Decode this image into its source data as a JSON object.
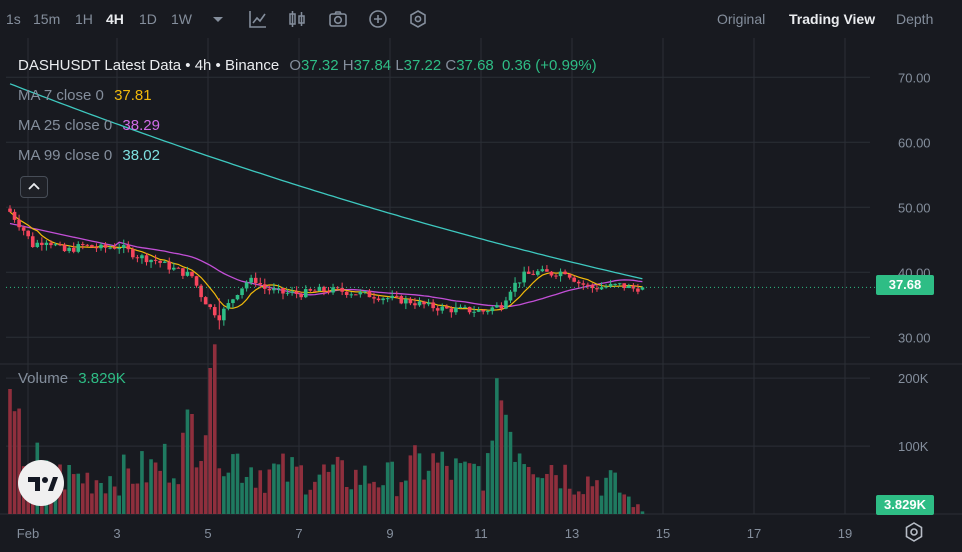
{
  "toolbar": {
    "timeframes": [
      "1s",
      "15m",
      "1H",
      "4H",
      "1D",
      "1W"
    ],
    "active_timeframe": "4H",
    "views": [
      "Original",
      "Trading View",
      "Depth"
    ],
    "active_view": "Trading View",
    "tools": [
      "dropdown-caret-icon",
      "indicator-chart-icon",
      "candle-settings-icon",
      "camera-icon",
      "add-icon",
      "settings-icon"
    ]
  },
  "legend": {
    "title": "DASHUSDT Latest Data • 4h • Binance",
    "ohlc": [
      {
        "k": "O",
        "v": "37.32"
      },
      {
        "k": "H",
        "v": "37.84"
      },
      {
        "k": "L",
        "v": "37.22"
      },
      {
        "k": "C",
        "v": "37.68"
      }
    ],
    "change": "0.36 (+0.99%)",
    "ma7_label": "MA 7 close 0",
    "ma7_value": "37.81",
    "ma25_label": "MA 25 close 0",
    "ma25_value": "38.29",
    "ma99_label": "MA 99 close 0",
    "ma99_value": "38.02",
    "volume_label": "Volume",
    "volume_value": "3.829K"
  },
  "price_tag": "37.68",
  "volume_tag": "3.829K",
  "colors": {
    "up": "#2ebd85",
    "down": "#f6465d",
    "up_vol": "#1f7a60",
    "down_vol": "#8f2f3d",
    "ma7": "#f0b90b",
    "ma25": "#c24fd6",
    "ma99": "#3ec9c0",
    "grid": "#2b2f36",
    "ma7_text": "#f0b90b",
    "ma25_text": "#d16ce8",
    "ma99_text": "#7ee0e0"
  },
  "chart_data": {
    "type": "candlestick",
    "price_axis": {
      "ticks": [
        "70.00",
        "60.00",
        "50.00",
        "40.00",
        "30.00"
      ],
      "tick_values": [
        70,
        60,
        50,
        40,
        30
      ],
      "range": [
        26.5,
        74.5
      ]
    },
    "volume_axis": {
      "ticks": [
        "200K",
        "100K"
      ],
      "tick_values": [
        200000,
        100000
      ],
      "range": [
        0,
        215000
      ]
    },
    "x_axis": {
      "labels": [
        "Feb",
        "3",
        "5",
        "7",
        "9",
        "11",
        "13",
        "15",
        "17",
        "19"
      ]
    },
    "anchors": [
      [
        0,
        49.3
      ],
      [
        3,
        46.5
      ],
      [
        5,
        44.2
      ],
      [
        8,
        45.0
      ],
      [
        12,
        43.2
      ],
      [
        16,
        44.1
      ],
      [
        20,
        43.7
      ],
      [
        24,
        44.0
      ],
      [
        28,
        42.5
      ],
      [
        32,
        41.8
      ],
      [
        36,
        40.5
      ],
      [
        40,
        39.4
      ],
      [
        42,
        36.5
      ],
      [
        44,
        34.5
      ],
      [
        46,
        33.2
      ],
      [
        48,
        35.0
      ],
      [
        50,
        37.0
      ],
      [
        52,
        38.5
      ],
      [
        54,
        38.8
      ],
      [
        56,
        37.5
      ],
      [
        60,
        36.8
      ],
      [
        64,
        36.7
      ],
      [
        68,
        37.2
      ],
      [
        72,
        37.2
      ],
      [
        76,
        36.8
      ],
      [
        80,
        36.4
      ],
      [
        84,
        35.9
      ],
      [
        88,
        35.5
      ],
      [
        92,
        34.8
      ],
      [
        96,
        34.3
      ],
      [
        100,
        34.2
      ],
      [
        104,
        34.0
      ],
      [
        108,
        35.0
      ],
      [
        110,
        37.5
      ],
      [
        113,
        39.5
      ],
      [
        116,
        40.0
      ],
      [
        119,
        39.8
      ],
      [
        122,
        40.2
      ],
      [
        125,
        38.4
      ],
      [
        128,
        37.6
      ],
      [
        131,
        37.8
      ],
      [
        134,
        38.0
      ],
      [
        137,
        37.5
      ],
      [
        139,
        37.68
      ]
    ],
    "vol_anchors": [
      [
        0,
        130000
      ],
      [
        8,
        60000
      ],
      [
        20,
        55000
      ],
      [
        32,
        70000
      ],
      [
        38,
        100000
      ],
      [
        44,
        200000
      ],
      [
        48,
        90000
      ],
      [
        56,
        65000
      ],
      [
        70,
        60000
      ],
      [
        84,
        55000
      ],
      [
        92,
        80000
      ],
      [
        100,
        60000
      ],
      [
        106,
        75000
      ],
      [
        107,
        200000
      ],
      [
        112,
        110000
      ],
      [
        116,
        90000
      ],
      [
        124,
        55000
      ],
      [
        132,
        50000
      ],
      [
        139,
        4000
      ]
    ],
    "volume_last": 3829,
    "bar_count": 140
  }
}
